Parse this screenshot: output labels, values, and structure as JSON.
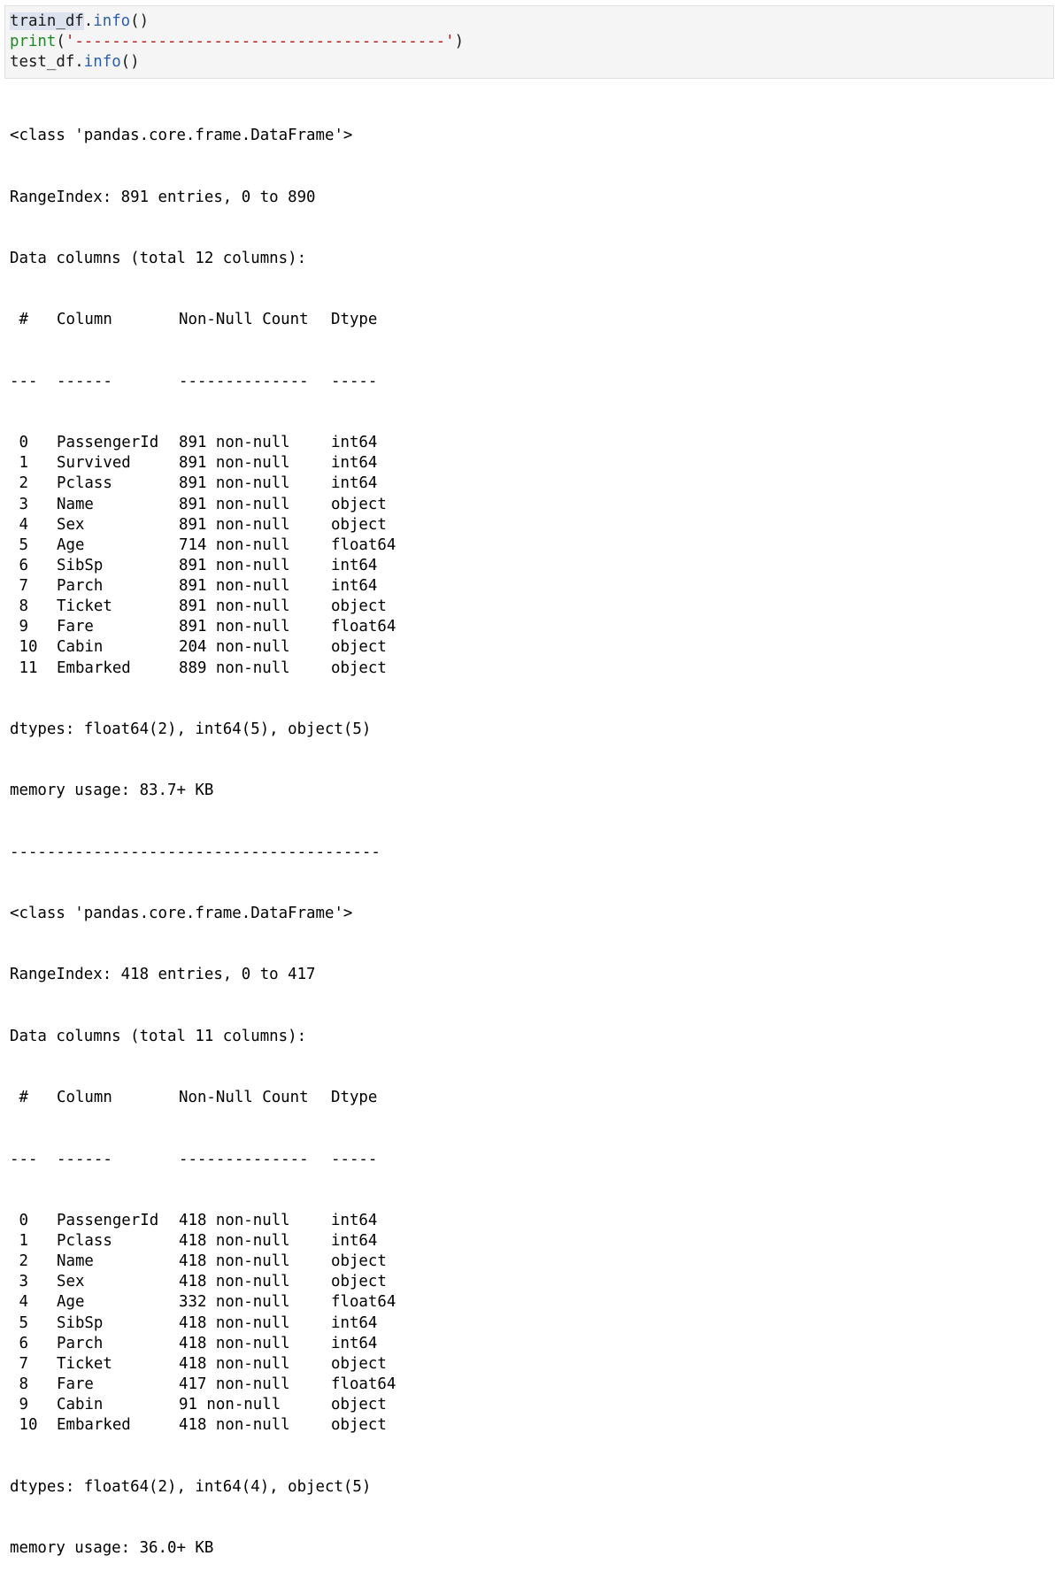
{
  "cell": {
    "code": {
      "line1": {
        "obj": "train_df",
        "dot": ".",
        "method": "info",
        "paren": "()"
      },
      "line2": {
        "fn": "print",
        "open": "(",
        "str": "'----------------------------------------'",
        "close": ")"
      },
      "line3": {
        "obj": "test_df",
        "dot": ".",
        "method": "info",
        "paren": "()"
      }
    }
  },
  "output": {
    "train": {
      "class_line": "<class 'pandas.core.frame.DataFrame'>",
      "range_index": "RangeIndex: 891 entries, 0 to 890",
      "data_columns": "Data columns (total 12 columns):",
      "header": {
        "num": " #",
        "column": "Column",
        "non_null": "Non-Null Count",
        "dtype": "Dtype"
      },
      "separator": {
        "num": "---",
        "column": "------",
        "non_null": "--------------",
        "dtype": "-----"
      },
      "rows": [
        {
          "num": " 0",
          "column": "PassengerId",
          "non_null": "891 non-null",
          "dtype": "int64"
        },
        {
          "num": " 1",
          "column": "Survived",
          "non_null": "891 non-null",
          "dtype": "int64"
        },
        {
          "num": " 2",
          "column": "Pclass",
          "non_null": "891 non-null",
          "dtype": "int64"
        },
        {
          "num": " 3",
          "column": "Name",
          "non_null": "891 non-null",
          "dtype": "object"
        },
        {
          "num": " 4",
          "column": "Sex",
          "non_null": "891 non-null",
          "dtype": "object"
        },
        {
          "num": " 5",
          "column": "Age",
          "non_null": "714 non-null",
          "dtype": "float64"
        },
        {
          "num": " 6",
          "column": "SibSp",
          "non_null": "891 non-null",
          "dtype": "int64"
        },
        {
          "num": " 7",
          "column": "Parch",
          "non_null": "891 non-null",
          "dtype": "int64"
        },
        {
          "num": " 8",
          "column": "Ticket",
          "non_null": "891 non-null",
          "dtype": "object"
        },
        {
          "num": " 9",
          "column": "Fare",
          "non_null": "891 non-null",
          "dtype": "float64"
        },
        {
          "num": " 10",
          "column": "Cabin",
          "non_null": "204 non-null",
          "dtype": "object"
        },
        {
          "num": " 11",
          "column": "Embarked",
          "non_null": "889 non-null",
          "dtype": "object"
        }
      ],
      "dtypes": "dtypes: float64(2), int64(5), object(5)",
      "memory": "memory usage: 83.7+ KB"
    },
    "divider": "----------------------------------------",
    "test": {
      "class_line": "<class 'pandas.core.frame.DataFrame'>",
      "range_index": "RangeIndex: 418 entries, 0 to 417",
      "data_columns": "Data columns (total 11 columns):",
      "header": {
        "num": " #",
        "column": "Column",
        "non_null": "Non-Null Count",
        "dtype": "Dtype"
      },
      "separator": {
        "num": "---",
        "column": "------",
        "non_null": "--------------",
        "dtype": "-----"
      },
      "rows": [
        {
          "num": " 0",
          "column": "PassengerId",
          "non_null": "418 non-null",
          "dtype": "int64"
        },
        {
          "num": " 1",
          "column": "Pclass",
          "non_null": "418 non-null",
          "dtype": "int64"
        },
        {
          "num": " 2",
          "column": "Name",
          "non_null": "418 non-null",
          "dtype": "object"
        },
        {
          "num": " 3",
          "column": "Sex",
          "non_null": "418 non-null",
          "dtype": "object"
        },
        {
          "num": " 4",
          "column": "Age",
          "non_null": "332 non-null",
          "dtype": "float64"
        },
        {
          "num": " 5",
          "column": "SibSp",
          "non_null": "418 non-null",
          "dtype": "int64"
        },
        {
          "num": " 6",
          "column": "Parch",
          "non_null": "418 non-null",
          "dtype": "int64"
        },
        {
          "num": " 7",
          "column": "Ticket",
          "non_null": "418 non-null",
          "dtype": "object"
        },
        {
          "num": " 8",
          "column": "Fare",
          "non_null": "417 non-null",
          "dtype": "float64"
        },
        {
          "num": " 9",
          "column": "Cabin",
          "non_null": "91 non-null",
          "dtype": "object"
        },
        {
          "num": " 10",
          "column": "Embarked",
          "non_null": "418 non-null",
          "dtype": "object"
        }
      ],
      "dtypes": "dtypes: float64(2), int64(4), object(5)",
      "memory": "memory usage: 36.0+ KB"
    }
  }
}
